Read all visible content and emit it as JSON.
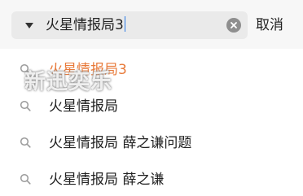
{
  "search": {
    "query": "火星情报局3",
    "cancel_label": "取消"
  },
  "suggestions": [
    {
      "label": "火星情报局3",
      "highlight": true
    },
    {
      "label": "火星情报局",
      "highlight": false
    },
    {
      "label": "火星情报局 薛之谦问题",
      "highlight": false
    },
    {
      "label": "火星情报局 薛之谦",
      "highlight": false
    }
  ],
  "watermark": "新迅奕乐",
  "colors": {
    "highlight": "#e87a3a",
    "caret": "#2c7be5",
    "search_bg": "#eaeaea"
  },
  "icons": {
    "dropdown": "chevron-down-icon",
    "clear": "clear-icon",
    "search": "search-icon"
  }
}
